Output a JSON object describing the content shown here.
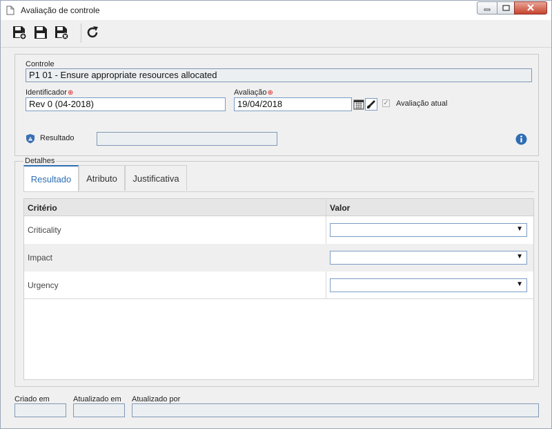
{
  "window": {
    "title": "Avaliação de controle",
    "controls": {
      "minimize": "minimize",
      "maximize": "maximize",
      "close": "close"
    }
  },
  "toolbar": {
    "buttons": [
      {
        "name": "save-and-new",
        "icon": "floppy-plus-icon"
      },
      {
        "name": "save",
        "icon": "floppy-icon"
      },
      {
        "name": "save-and-close",
        "icon": "floppy-close-icon"
      },
      {
        "name": "refresh",
        "icon": "refresh-icon"
      }
    ]
  },
  "form": {
    "controle_label": "Controle",
    "controle_value": "P1 01 - Ensure appropriate resources allocated",
    "identificador_label": "Identificador",
    "identificador_value": "Rev 0 (04-2018)",
    "avaliacao_label": "Avaliação",
    "avaliacao_value": "19/04/2018",
    "avaliacao_atual_label": "Avaliação atual",
    "avaliacao_atual_checked": true,
    "resultado_label": "Resultado",
    "resultado_value": "",
    "required_mark": "⊕"
  },
  "details": {
    "legend": "Detalhes",
    "tabs": [
      "Resultado",
      "Atributo",
      "Justificativa"
    ],
    "active_tab": "Resultado",
    "grid": {
      "headers": [
        "Critério",
        "Valor"
      ],
      "rows": [
        {
          "criterio": "Criticality",
          "valor": ""
        },
        {
          "criterio": "Impact",
          "valor": ""
        },
        {
          "criterio": "Urgency",
          "valor": ""
        }
      ]
    }
  },
  "footer": {
    "criado_em_label": "Criado em",
    "criado_em_value": "",
    "atualizado_em_label": "Atualizado em",
    "atualizado_em_value": "",
    "atualizado_por_label": "Atualizado por",
    "atualizado_por_value": ""
  },
  "colors": {
    "accent": "#2e6db4",
    "required": "#d32020",
    "field_border": "#7a9cc5",
    "close_button": "#c7442f"
  }
}
